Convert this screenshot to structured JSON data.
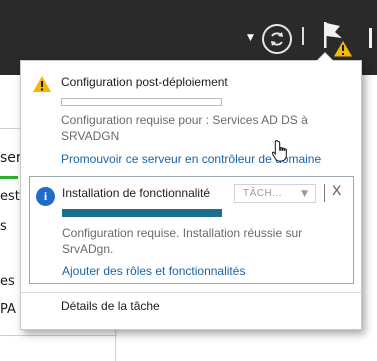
{
  "toolbar": {
    "dropdown_icon": "chevron-down-icon",
    "refresh_icon": "refresh-icon",
    "flag_icon": "notification-flag-icon",
    "warning_badge_icon": "warning-icon"
  },
  "background": {
    "fragments": [
      "serve",
      "est",
      "s",
      "es",
      "PA"
    ]
  },
  "popup": {
    "sections": [
      {
        "icon": "warning-icon",
        "title": "Configuration post-déploiement",
        "progress": 0,
        "description": "Configuration requise pour : Services AD DS à SRVADGN",
        "link": "Promouvoir ce serveur en contrôleur de domaine"
      },
      {
        "icon": "info-icon",
        "title": "Installation de fonctionnalité",
        "task_select": "TÂCH...",
        "close_label": "X",
        "progress": 1,
        "description": "Configuration requise. Installation réussie sur SrvADgn.",
        "link": "Ajouter des rôles et fonctionnalités"
      }
    ],
    "footer_link": "Détails de la tâche"
  },
  "colors": {
    "toolbar_bg": "#2a2a2a",
    "link": "#1a64a8",
    "progress_fill": "#1c6f8b",
    "warning": "#f5b800",
    "info": "#1e6cc8"
  }
}
